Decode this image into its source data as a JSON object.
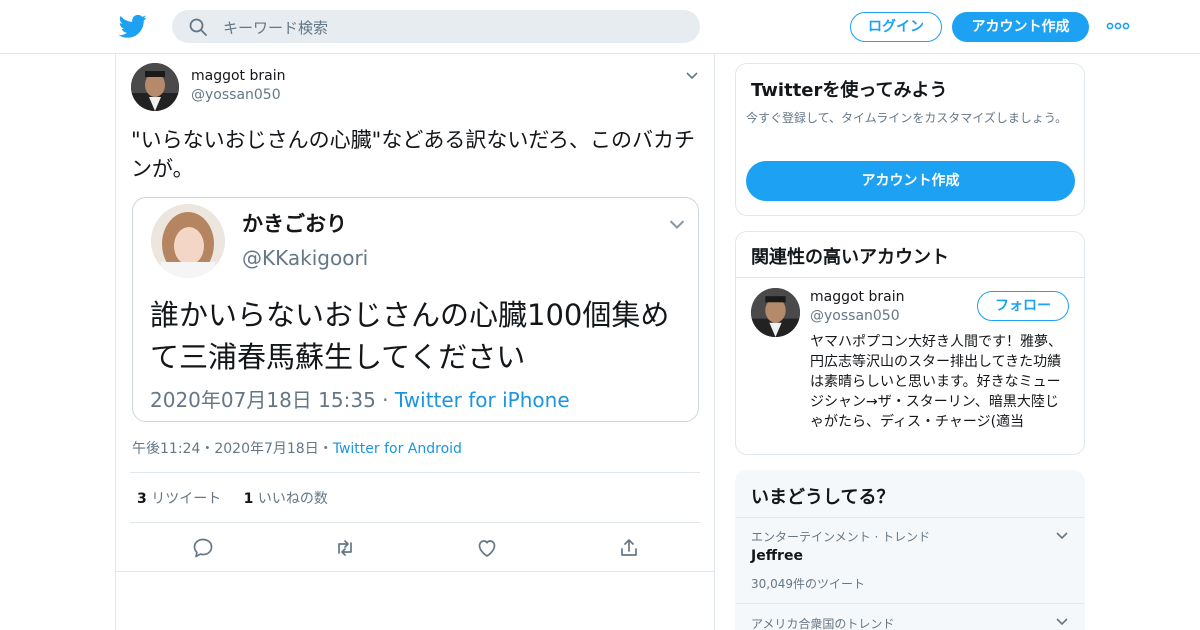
{
  "header": {
    "search_placeholder": "キーワード検索",
    "login_label": "ログイン",
    "signup_label": "アカウント作成",
    "accent": "#1da1f2"
  },
  "tweet": {
    "author_name": "maggot brain",
    "author_handle": "@yossan050",
    "text": "\"いらないおじさんの心臓\"などある訳ないだろ、このバカチンが。",
    "quote": {
      "author_name": "かきごおり",
      "author_handle": "@KKakigoori",
      "text": "誰かいらないおじさんの心臓100個集めて三浦春馬蘇生してください",
      "datetime": "2020年07月18日 15:35",
      "separator": " · ",
      "source": "Twitter for iPhone"
    },
    "time": "午後11:24",
    "date": "2020年7月18日",
    "source": "Twitter for Android",
    "meta_sep": "・",
    "retweets_count": "3",
    "retweets_label": "リツイート",
    "likes_count": "1",
    "likes_label": "いいねの数"
  },
  "sidebar": {
    "signup_card": {
      "title": "Twitterを使ってみよう",
      "subtitle": "今すぐ登録して、タイムラインをカスタマイズしましょう。",
      "button": "アカウント作成"
    },
    "related": {
      "title": "関連性の高いアカウント",
      "name": "maggot brain",
      "handle": "@yossan050",
      "follow_label": "フォロー",
      "bio": "ヤマハポプコン大好き人間です！雅夢、円広志等沢山のスター排出してきた功績は素晴らしいと思います。好きなミュージシャン→ザ・スターリン、暗黒大陸じゃがたら、ディス・チャージ(適当"
    },
    "trends": {
      "title": "いまどうしてる？",
      "items": [
        {
          "context": "エンターテインメント · トレンド",
          "name": "Jeffree",
          "count": "30,049件のツイート"
        },
        {
          "context": "アメリカ合衆国のトレンド"
        }
      ]
    }
  }
}
